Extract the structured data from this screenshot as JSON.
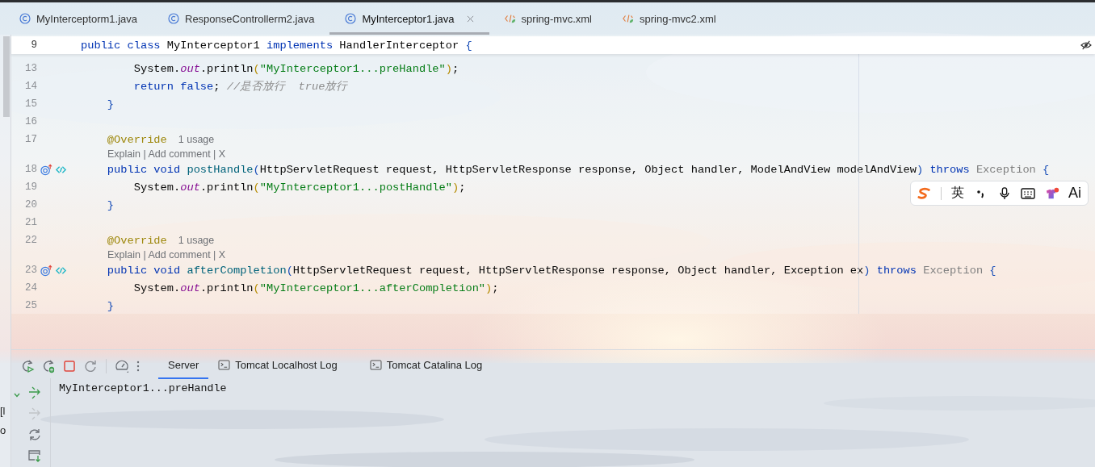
{
  "editor_tabs": [
    {
      "label": "MyInterceptorm1.java",
      "kind": "java",
      "selected": false
    },
    {
      "label": "ResponseControllerm2.java",
      "kind": "java",
      "selected": false
    },
    {
      "label": "MyInterceptor1.java",
      "kind": "java",
      "selected": true
    },
    {
      "label": "spring-mvc.xml",
      "kind": "xml",
      "selected": false
    },
    {
      "label": "spring-mvc2.xml",
      "kind": "xml",
      "selected": false
    }
  ],
  "sticky_line": {
    "number": "9",
    "tokens": [
      {
        "kind": "kw",
        "text": "public class "
      },
      {
        "kind": "plain",
        "text": "MyInterceptor1 "
      },
      {
        "kind": "kw",
        "text": "implements "
      },
      {
        "kind": "plain",
        "text": "HandlerInterceptor "
      },
      {
        "kind": "brace",
        "text": "{"
      }
    ]
  },
  "code_rows": [
    {
      "kind": "code",
      "number": "13",
      "tokens": [
        {
          "kind": "plain",
          "text": "        System."
        },
        {
          "kind": "field",
          "text": "out"
        },
        {
          "kind": "plain",
          "text": ".println"
        },
        {
          "kind": "gold",
          "text": "("
        },
        {
          "kind": "str",
          "text": "\"MyInterceptor1...preHandle\""
        },
        {
          "kind": "gold",
          "text": ")"
        },
        {
          "kind": "plain",
          "text": ";"
        }
      ]
    },
    {
      "kind": "code",
      "number": "14",
      "tokens": [
        {
          "kind": "kw",
          "text": "        return false"
        },
        {
          "kind": "plain",
          "text": "; "
        },
        {
          "kind": "comment",
          "text": "//是否放行  true放行"
        }
      ]
    },
    {
      "kind": "code",
      "number": "15",
      "tokens": [
        {
          "kind": "brace",
          "text": "    }"
        }
      ]
    },
    {
      "kind": "code",
      "number": "16",
      "tokens": []
    },
    {
      "kind": "code",
      "number": "17",
      "tokens": [
        {
          "kind": "annot",
          "text": "    @Override"
        }
      ],
      "hint": "1 usage"
    },
    {
      "kind": "lens",
      "text": "Explain | Add comment | X"
    },
    {
      "kind": "method",
      "number": "18",
      "tokens": [
        {
          "kind": "kw",
          "text": "    public void "
        },
        {
          "kind": "method",
          "text": "postHandle"
        },
        {
          "kind": "brace",
          "text": "("
        },
        {
          "kind": "plain",
          "text": "HttpServletRequest request, HttpServletResponse response, Object handler, ModelAndView modelAndView"
        },
        {
          "kind": "brace",
          "text": ") "
        },
        {
          "kind": "kw",
          "text": "throws "
        },
        {
          "kind": "muted",
          "text": "Exception "
        },
        {
          "kind": "brace",
          "text": "{"
        }
      ]
    },
    {
      "kind": "code",
      "number": "19",
      "tokens": [
        {
          "kind": "plain",
          "text": "        System."
        },
        {
          "kind": "field",
          "text": "out"
        },
        {
          "kind": "plain",
          "text": ".println"
        },
        {
          "kind": "gold",
          "text": "("
        },
        {
          "kind": "str",
          "text": "\"MyInterceptor1...postHandle\""
        },
        {
          "kind": "gold",
          "text": ")"
        },
        {
          "kind": "plain",
          "text": ";"
        }
      ]
    },
    {
      "kind": "code",
      "number": "20",
      "tokens": [
        {
          "kind": "brace",
          "text": "    }"
        }
      ]
    },
    {
      "kind": "code",
      "number": "21",
      "tokens": []
    },
    {
      "kind": "code",
      "number": "22",
      "tokens": [
        {
          "kind": "annot",
          "text": "    @Override"
        }
      ],
      "hint": "1 usage"
    },
    {
      "kind": "lens",
      "text": "Explain | Add comment | X"
    },
    {
      "kind": "method",
      "number": "23",
      "tokens": [
        {
          "kind": "kw",
          "text": "    public void "
        },
        {
          "kind": "method",
          "text": "afterCompletion"
        },
        {
          "kind": "brace",
          "text": "("
        },
        {
          "kind": "plain",
          "text": "HttpServletRequest request, HttpServletResponse response, Object handler, Exception ex"
        },
        {
          "kind": "brace",
          "text": ") "
        },
        {
          "kind": "kw",
          "text": "throws "
        },
        {
          "kind": "muted",
          "text": "Exception "
        },
        {
          "kind": "brace",
          "text": "{"
        }
      ]
    },
    {
      "kind": "code",
      "number": "24",
      "tokens": [
        {
          "kind": "plain",
          "text": "        System."
        },
        {
          "kind": "field",
          "text": "out"
        },
        {
          "kind": "plain",
          "text": ".println"
        },
        {
          "kind": "gold",
          "text": "("
        },
        {
          "kind": "str",
          "text": "\"MyInterceptor1...afterCompletion\""
        },
        {
          "kind": "gold",
          "text": ")"
        },
        {
          "kind": "plain",
          "text": ";"
        }
      ]
    },
    {
      "kind": "code",
      "number": "25",
      "tokens": [
        {
          "kind": "brace",
          "text": "    }"
        }
      ]
    }
  ],
  "ime_toolbar": {
    "language": "英",
    "ai": "Ai"
  },
  "run_panel": {
    "toolbar": [
      {
        "kind": "rerun"
      },
      {
        "kind": "rerun-debug"
      },
      {
        "kind": "stop"
      },
      {
        "kind": "restart"
      },
      {
        "kind": "separator"
      },
      {
        "kind": "gauge"
      },
      {
        "kind": "more"
      }
    ],
    "tabs": [
      {
        "label": "Server",
        "kind": "plain",
        "selected": true
      },
      {
        "label": "Tomcat Localhost Log",
        "kind": "terminal",
        "selected": false
      },
      {
        "label": "Tomcat Catalina Log",
        "kind": "terminal",
        "selected": false
      }
    ],
    "side_actions": [
      {
        "kind": "deploy",
        "disabled": false
      },
      {
        "kind": "undeploy",
        "disabled": true
      },
      {
        "kind": "refresh",
        "disabled": false
      },
      {
        "kind": "dump",
        "disabled": false
      }
    ],
    "output": "MyInterceptor1...preHandle"
  },
  "left_edge": [
    "[l",
    "o"
  ]
}
